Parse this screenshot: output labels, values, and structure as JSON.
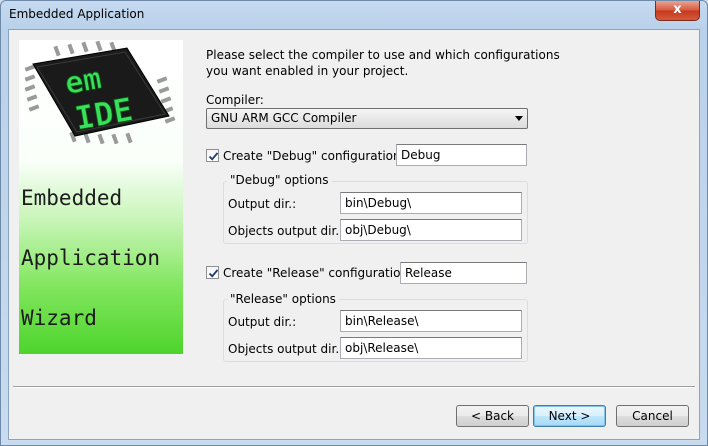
{
  "window": {
    "title": "Embedded Application",
    "close_glyph": "x"
  },
  "banner": {
    "logo_top": "em",
    "logo_bottom": "IDE",
    "wizard_lines": [
      "Embedded",
      "Application",
      "Wizard"
    ],
    "colors": {
      "green": "#4ed42d",
      "chip": "#1a1a1a",
      "logo_text": "#39e05a"
    }
  },
  "intro": {
    "line1": "Please select the compiler to use and which configurations",
    "line2": "you want enabled in your project."
  },
  "compiler": {
    "label": "Compiler:",
    "selected": "GNU ARM GCC Compiler"
  },
  "debug": {
    "checkbox_label": "Create \"Debug\" configuration:",
    "checked": true,
    "name_value": "Debug",
    "group_title": "\"Debug\" options",
    "output_label": "Output dir.:",
    "output_value": "bin\\Debug\\",
    "objects_label": "Objects output dir.:",
    "objects_value": "obj\\Debug\\"
  },
  "release": {
    "checkbox_label": "Create \"Release\" configuration:",
    "checked": true,
    "name_value": "Release",
    "group_title": "\"Release\" options",
    "output_label": "Output dir.:",
    "output_value": "bin\\Release\\",
    "objects_label": "Objects output dir.:",
    "objects_value": "obj\\Release\\"
  },
  "buttons": {
    "back": "< Back",
    "next": "Next >",
    "cancel": "Cancel"
  }
}
